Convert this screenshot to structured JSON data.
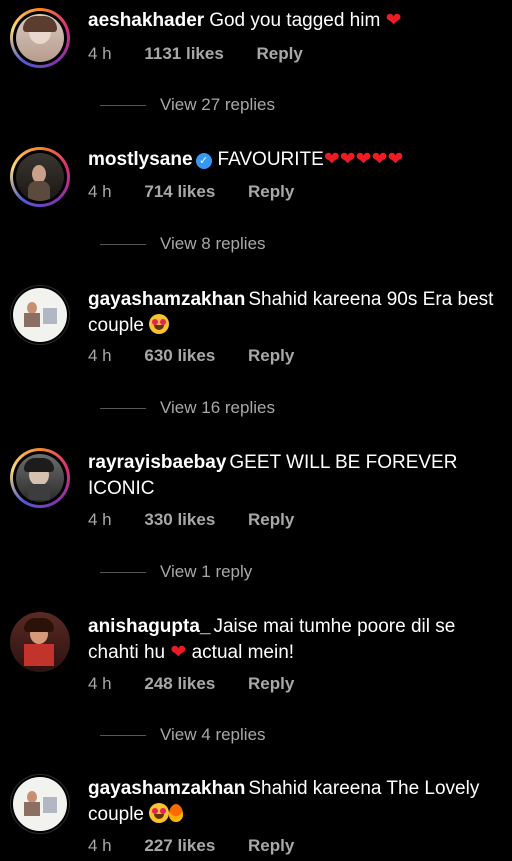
{
  "comments": [
    {
      "username": "aeshakhader",
      "text": "God you tagged him",
      "time": "4 h",
      "likes": "1131 likes",
      "reply": "Reply",
      "view_replies": "View 27 replies"
    },
    {
      "username": "mostlysane",
      "text": "FAVOURITE",
      "time": "4 h",
      "likes": "714 likes",
      "reply": "Reply",
      "view_replies": "View 8 replies"
    },
    {
      "username": "gayashamzakhan",
      "text": "Shahid kareena 90s Era best couple",
      "time": "4 h",
      "likes": "630 likes",
      "reply": "Reply",
      "view_replies": "View 16 replies"
    },
    {
      "username": "rayrayisbaebay",
      "text": "GEET WILL BE FOREVER ICONIC",
      "time": "4 h",
      "likes": "330 likes",
      "reply": "Reply",
      "view_replies": "View 1 reply"
    },
    {
      "username": "anishagupta_",
      "text_before": "Jaise mai tumhe poore dil se chahti hu",
      "text_after": "actual mein!",
      "time": "4 h",
      "likes": "248 likes",
      "reply": "Reply",
      "view_replies": "View 4 replies"
    },
    {
      "username": "gayashamzakhan",
      "text": "Shahid kareena The Lovely couple",
      "time": "4 h",
      "likes": "227 likes",
      "reply": "Reply"
    }
  ],
  "colors": {
    "background": "#000000",
    "secondary_text": "#a8a8a8",
    "heart": "#ed1c24",
    "verified": "#3897f0"
  }
}
